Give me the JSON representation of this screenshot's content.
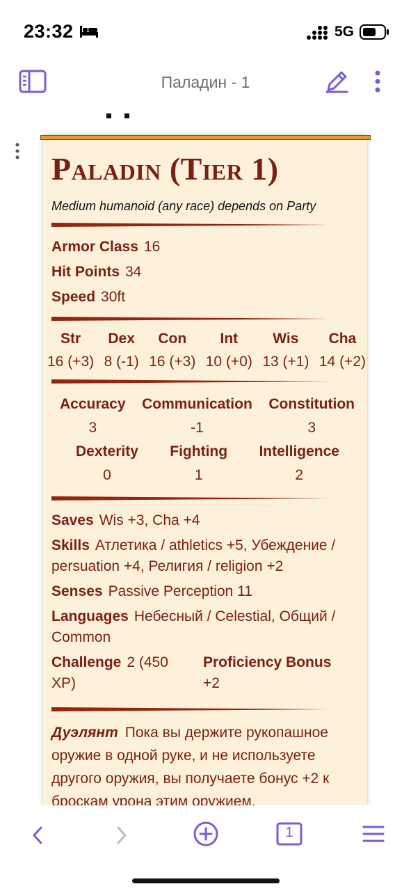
{
  "status": {
    "time": "23:32",
    "network": "5G"
  },
  "nav": {
    "title": "Паладин - 1"
  },
  "statblock": {
    "title": "Paladin (Tier 1)",
    "subtitle": "Medium humanoid (any race) depends on Party",
    "armor_class": {
      "label": "Armor Class",
      "value": "16"
    },
    "hit_points": {
      "label": "Hit Points",
      "value": "34"
    },
    "speed": {
      "label": "Speed",
      "value": "30ft"
    },
    "abilities": [
      {
        "name": "Str",
        "value": "16 (+3)"
      },
      {
        "name": "Dex",
        "value": "8 (-1)"
      },
      {
        "name": "Con",
        "value": "16 (+3)"
      },
      {
        "name": "Int",
        "value": "10 (+0)"
      },
      {
        "name": "Wis",
        "value": "13 (+1)"
      },
      {
        "name": "Cha",
        "value": "14 (+2)"
      }
    ],
    "skills_row1": [
      {
        "name": "Accuracy",
        "value": "3"
      },
      {
        "name": "Communication",
        "value": "-1"
      },
      {
        "name": "Constitution",
        "value": "3"
      }
    ],
    "skills_row2": [
      {
        "name": "Dexterity",
        "value": "0"
      },
      {
        "name": "Fighting",
        "value": "1"
      },
      {
        "name": "Intelligence",
        "value": "2"
      }
    ],
    "saves": {
      "label": "Saves",
      "value": "Wis +3, Cha +4"
    },
    "skills": {
      "label": "Skills",
      "value": "Атлетика / athletics +5, Убеждение / persuation +4, Религия / religion +2"
    },
    "senses": {
      "label": "Senses",
      "value": "Passive Perception 11"
    },
    "languages": {
      "label": "Languages",
      "value": "Небесный / Celestial, Общий / Common"
    },
    "challenge": {
      "label": "Challenge",
      "value": "2 (450 XP)"
    },
    "proficiency": {
      "label": "Proficiency Bonus",
      "value": "+2"
    },
    "trait": {
      "name": "Дуэлянт",
      "text": "Пока вы держите рукопашное оружие в одной руке, и не используете другого оружия, вы получаете бонус +2 к броскам урона этим оружием."
    }
  },
  "toolbar": {
    "page_count": "1"
  },
  "colors": {
    "accent": "#7a5cd6",
    "statblock_text": "#7a1f11",
    "parchment": "#fdf1dc",
    "gold_bar": "#e69a28"
  }
}
